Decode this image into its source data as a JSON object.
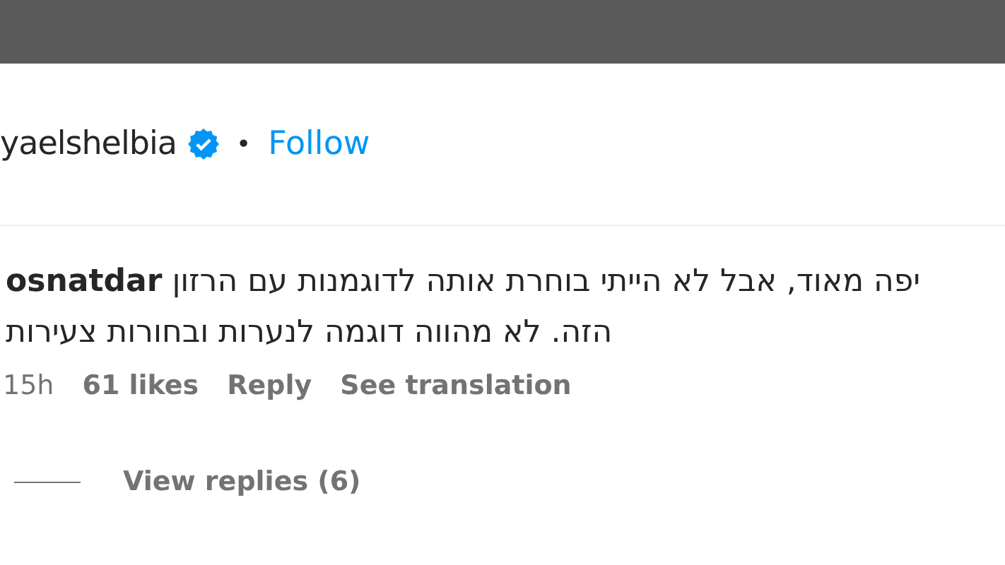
{
  "post_header": {
    "username": "yaelshelbia",
    "verified": true,
    "separator": "•",
    "follow": "Follow"
  },
  "comment": {
    "username": "osnatdar",
    "text": "יפה מאוד, אבל לא הייתי בוחרת אותה לדוגמנות עם הרזון הזה. לא מהווה דוגמה לנערות ובחורות צעירות",
    "time": "15h",
    "likes": "61 likes",
    "reply": "Reply",
    "translate": "See translation"
  },
  "replies": {
    "label": "View replies (6)"
  }
}
